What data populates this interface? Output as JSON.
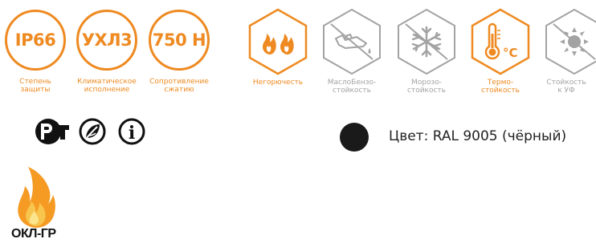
{
  "badges": [
    {
      "text": "IP66",
      "caption_line1": "Степень",
      "caption_line2": "защиты"
    },
    {
      "text": "УХЛ3",
      "caption_line1": "Климатическое",
      "caption_line2": "исполнение"
    },
    {
      "text": "750 Н",
      "caption_line1": "Сопротивление",
      "caption_line2": "сжатию"
    }
  ],
  "properties": [
    {
      "icon": "flame-icon",
      "caption_line1": "Негорючесть",
      "caption_line2": "",
      "active": true
    },
    {
      "icon": "oil-can-crossed-icon",
      "caption_line1": "МаслоБензо-",
      "caption_line2": "стойкость",
      "active": false
    },
    {
      "icon": "snowflake-crossed-icon",
      "caption_line1": "Морозо-",
      "caption_line2": "стойкость",
      "active": false
    },
    {
      "icon": "thermometer-icon",
      "caption_line1": "Термо-",
      "caption_line2": "стойкость",
      "active": true
    },
    {
      "icon": "sun-crossed-icon",
      "caption_line1": "Стойкость",
      "caption_line2": "к УФ",
      "active": false
    }
  ],
  "thermo_unit": "°C",
  "certifications": [
    "rst-mark-icon",
    "eco-leaf-icon",
    "info-icon"
  ],
  "info_glyph": "i",
  "color": {
    "label": "Цвет: RAL 9005 (чёрный)",
    "swatch": "#1a1a1a"
  },
  "okl": {
    "label": "ОКЛ-ГР"
  },
  "colors": {
    "accent": "#ee8a21",
    "inactive": "#a3a3a3"
  }
}
